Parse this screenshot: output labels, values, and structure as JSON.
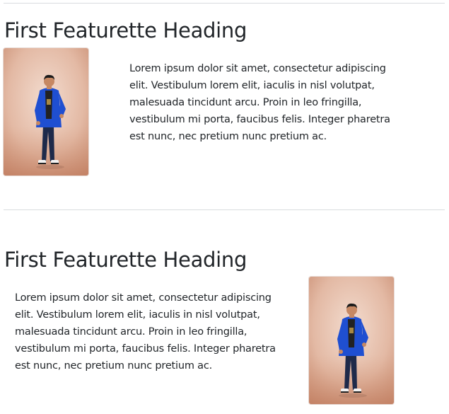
{
  "featurettes": [
    {
      "heading": "First Featurette Heading",
      "body": "Lorem ipsum dolor sit amet, consectetur adipiscing elit. Vestibulum lorem elit, iaculis in nisl volutpat, malesuada tincidunt arcu. Proin in leo fringilla, vestibulum mi porta, faucibus felis. Integer pharetra est nunc, nec pretium nunc pretium ac."
    },
    {
      "heading": "First Featurette Heading",
      "body": "Lorem ipsum dolor sit amet, consectetur adipiscing elit. Vestibulum lorem elit, iaculis in nisl volutpat, malesuada tincidunt arcu. Proin in leo fringilla, vestibulum mi porta, faucibus felis. Integer pharetra est nunc, nec pretium nunc pretium ac."
    }
  ],
  "colors": {
    "text": "#212529",
    "divider": "#d9dcdf",
    "photo_background": "#e6bfae",
    "jacket": "#1f4fd1"
  }
}
